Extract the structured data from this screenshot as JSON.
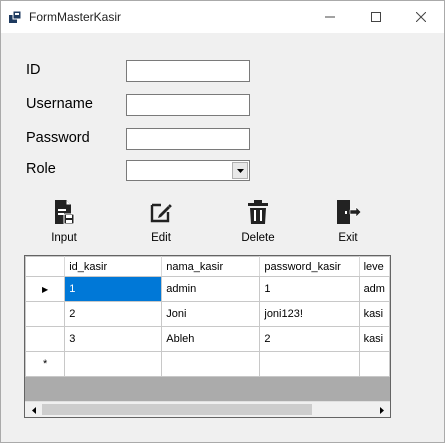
{
  "window": {
    "title": "FormMasterKasir"
  },
  "form": {
    "id_label": "ID",
    "username_label": "Username",
    "password_label": "Password",
    "role_label": "Role",
    "id_value": "",
    "username_value": "",
    "password_value": "",
    "role_value": ""
  },
  "toolbar": {
    "input_label": "Input",
    "edit_label": "Edit",
    "delete_label": "Delete",
    "exit_label": "Exit"
  },
  "grid": {
    "columns": [
      "id_kasir",
      "nama_kasir",
      "password_kasir",
      "leve"
    ],
    "rows": [
      [
        "1",
        "admin",
        "1",
        "adm"
      ],
      [
        "2",
        "Joni",
        "joni123!",
        "kasi"
      ],
      [
        "3",
        "Ableh",
        "2",
        "kasi"
      ]
    ],
    "current_row_marker": "▶",
    "new_row_marker": "*"
  },
  "icons": {
    "app": "app-icon",
    "input": "save-file-icon",
    "edit": "edit-pencil-icon",
    "delete": "trash-icon",
    "exit": "exit-door-icon"
  }
}
